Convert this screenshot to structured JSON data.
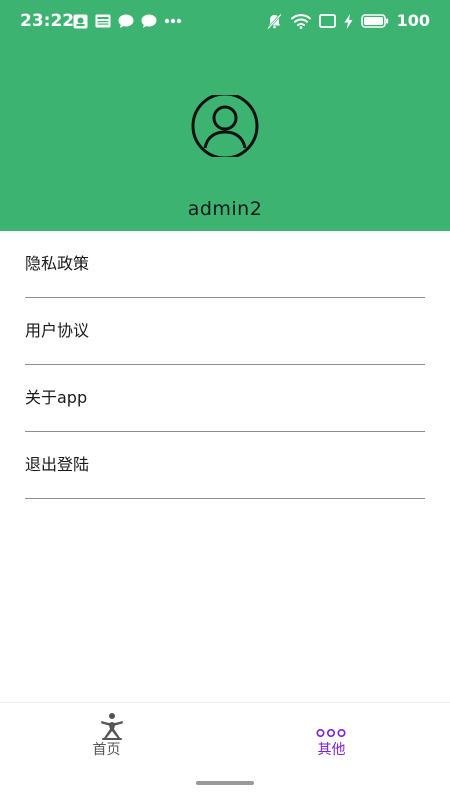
{
  "colors": {
    "header_bg": "#3db371",
    "tab_active": "#7b1fe0",
    "tab_inactive": "#555555"
  },
  "status_bar": {
    "time": "23:22",
    "left_icons": [
      "notification-icon",
      "news-icon",
      "chat-bubble-icon",
      "chat-bubble-icon",
      "more-dots-icon"
    ],
    "right_icons": [
      "mute-bell-icon",
      "wifi-icon",
      "screen-cast-icon",
      "charging-bolt-icon",
      "battery-icon"
    ],
    "battery": "100"
  },
  "profile": {
    "avatar_icon": "user-avatar-icon",
    "username": "admin2"
  },
  "menu": {
    "items": [
      {
        "label": "隐私政策"
      },
      {
        "label": "用户协议"
      },
      {
        "label": "关于app"
      },
      {
        "label": "退出登陆"
      }
    ]
  },
  "tabbar": {
    "tabs": [
      {
        "label": "首页",
        "icon": "home-person-icon",
        "active": false
      },
      {
        "label": "其他",
        "icon": "three-circles-icon",
        "active": true
      }
    ]
  }
}
